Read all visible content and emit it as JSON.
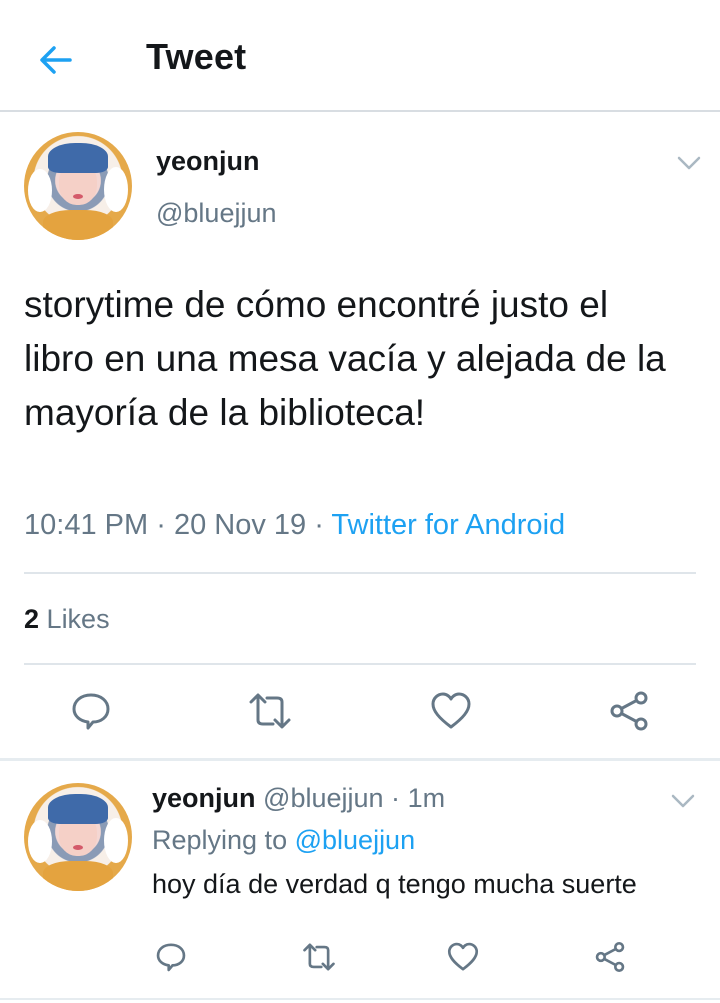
{
  "header": {
    "title": "Tweet",
    "back_icon": "back-arrow-icon",
    "accent": "#1da1f2"
  },
  "tweet": {
    "display_name": "yeonjun",
    "handle": "@bluejjun",
    "text": "storytime de cómo encontré justo el libro en una mesa vacía y alejada de la mayoría de la biblioteca!",
    "time": "10:41 PM",
    "date": "20 Nov 19",
    "separator": "·",
    "source": "Twitter for Android",
    "likes_count": "2",
    "likes_label": "Likes"
  },
  "reply": {
    "display_name": "yeonjun",
    "handle": "@bluejjun",
    "separator": "·",
    "age": "1m",
    "replying_label": "Replying to",
    "replying_to": "@bluejjun",
    "text": "hoy día de verdad q tengo mucha suerte"
  },
  "actions": [
    "reply-icon",
    "retweet-icon",
    "like-icon",
    "share-icon"
  ],
  "colors": {
    "text": "#14171a",
    "secondary": "#657786",
    "link": "#1da1f2",
    "divider": "#dfe5ea"
  }
}
